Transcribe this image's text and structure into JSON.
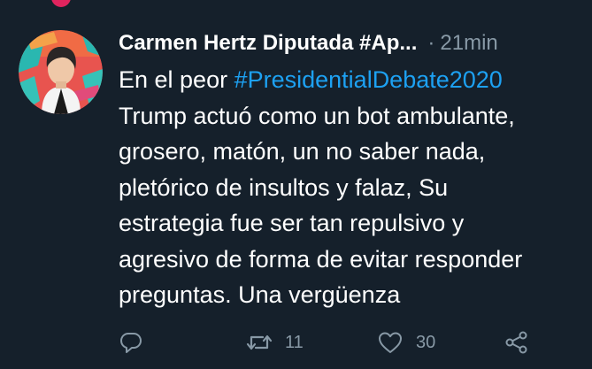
{
  "tweet": {
    "display_name": "Carmen Hertz Diputada #Ap...",
    "separator": "·",
    "time": "21min",
    "text_lines": [
      {
        "prefix": "En el peor ",
        "hashtag": "#PresidentialDebate2020"
      },
      {
        "text": "Trump actuó como un bot ambulante,"
      },
      {
        "text": "grosero, matón, un no saber nada,"
      },
      {
        "text": "pletórico de insultos y falaz, Su"
      },
      {
        "text": "estrategia fue ser tan repulsivo y"
      },
      {
        "text": "agresivo de forma de evitar responder"
      },
      {
        "text": "preguntas. Una vergüenza"
      }
    ],
    "actions": {
      "reply_icon": "reply-icon",
      "retweet_icon": "retweet-icon",
      "retweet_count": "11",
      "like_icon": "heart-icon",
      "like_count": "30",
      "share_icon": "share-icon"
    }
  },
  "colors": {
    "background": "#15202b",
    "text": "#ffffff",
    "secondary": "#8899a6",
    "link": "#1da1f2",
    "top_dot": "#e0245e"
  }
}
